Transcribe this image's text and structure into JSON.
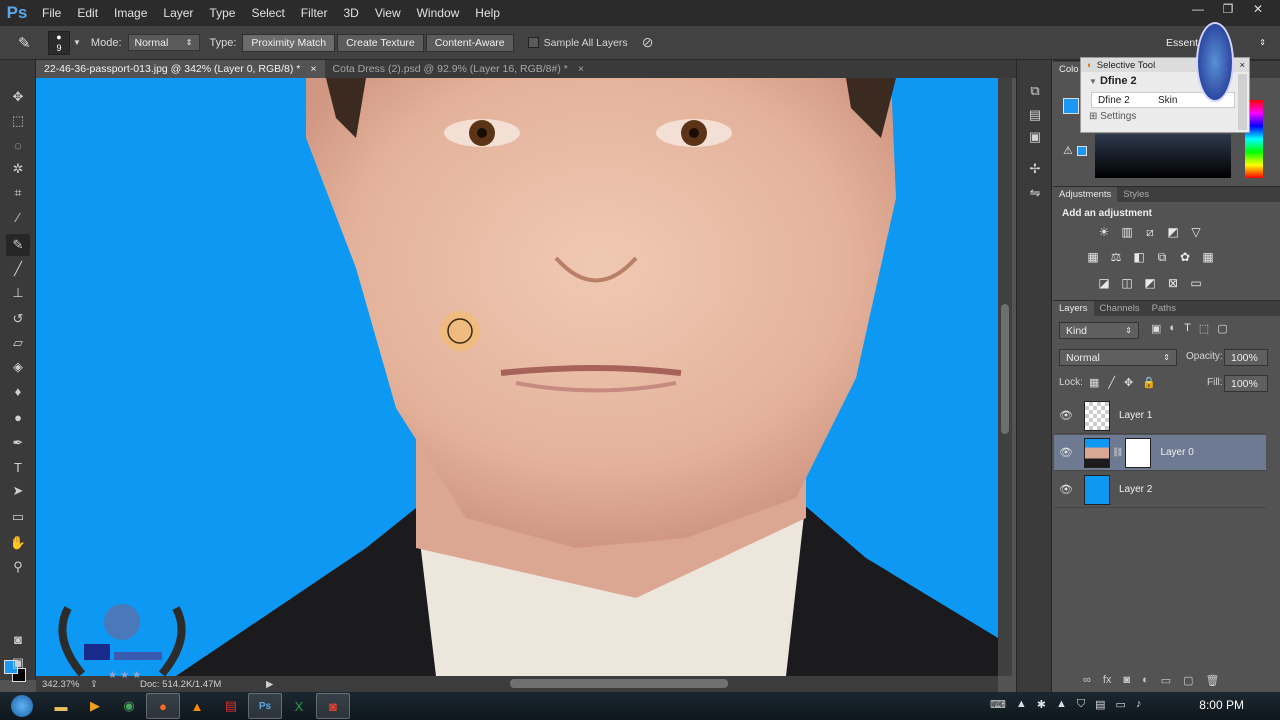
{
  "app": {
    "logo": "Ps"
  },
  "menu": [
    "File",
    "Edit",
    "Image",
    "Layer",
    "Type",
    "Select",
    "Filter",
    "3D",
    "View",
    "Window",
    "Help"
  ],
  "window_controls": {
    "minimize": "—",
    "restore": "❐",
    "close": "✕"
  },
  "options": {
    "brush_size": "9",
    "mode_label": "Mode:",
    "mode_value": "Normal",
    "type_label": "Type:",
    "type_buttons": [
      "Proximity Match",
      "Create Texture",
      "Content-Aware"
    ],
    "sample_all_layers": "Sample All Layers",
    "workspace": "Essent"
  },
  "tabs": [
    {
      "title": "22-46-36-passport-013.jpg @ 342% (Layer 0, RGB/8) *",
      "active": true
    },
    {
      "title": "Cota Dress (2).psd @ 92.9% (Layer 16, RGB/8#) *",
      "active": false
    }
  ],
  "tools": [
    "move-icon",
    "marquee-icon",
    "lasso-icon",
    "magic-wand-icon",
    "crop-icon",
    "eyedropper-icon",
    "healing-brush-icon",
    "brush-icon",
    "stamp-icon",
    "history-brush-icon",
    "eraser-icon",
    "paint-bucket-icon",
    "blur-icon",
    "dodge-icon",
    "pen-icon",
    "type-icon",
    "path-select-icon",
    "shape-icon",
    "hand-icon",
    "zoom-icon"
  ],
  "colors": {
    "foreground": "#1d97f5",
    "background": "#000000",
    "canvas_bg": "#0d98f3"
  },
  "status": {
    "zoom": "342.37%",
    "doc": "Doc: 514.2K/1.47M"
  },
  "color_panel": {
    "tab": "Colo"
  },
  "popup": {
    "title": "Selective Tool",
    "heading": "Dfine 2",
    "row_left": "Dfine 2",
    "row_right": "Skin",
    "settings": "Settings"
  },
  "adjustments": {
    "tabs": [
      "Adjustments",
      "Styles"
    ],
    "add_label": "Add an adjustment"
  },
  "layers": {
    "tabs": [
      "Layers",
      "Channels",
      "Paths"
    ],
    "kind": "Kind",
    "blend_mode": "Normal",
    "opacity_label": "Opacity:",
    "opacity_value": "100%",
    "lock_label": "Lock:",
    "fill_label": "Fill:",
    "fill_value": "100%",
    "items": [
      {
        "name": "Layer 1",
        "selected": false
      },
      {
        "name": "Layer 0",
        "selected": true
      },
      {
        "name": "Layer 2",
        "selected": false
      }
    ]
  },
  "taskbar": {
    "time": "8:00 PM"
  }
}
